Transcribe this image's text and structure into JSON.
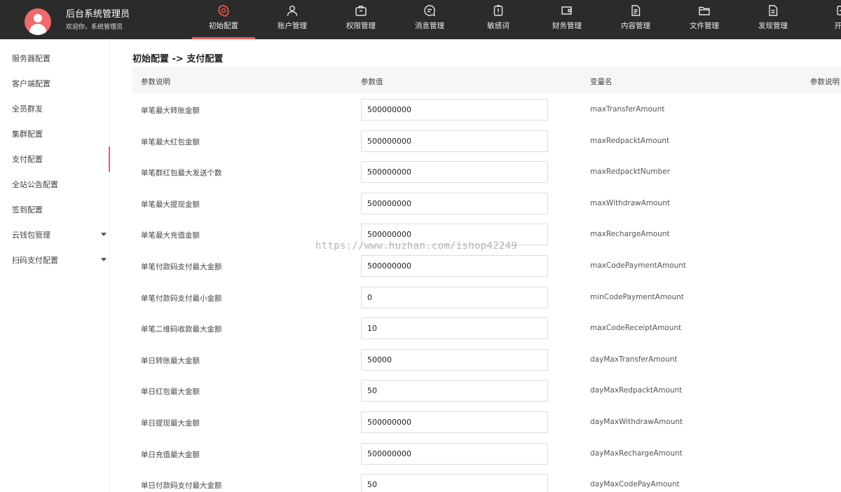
{
  "header": {
    "title": "后台系统管理员",
    "welcome": "欢迎你，系统管理员",
    "nav": [
      {
        "label": "初始配置",
        "icon": "gear-icon",
        "active": true
      },
      {
        "label": "账户管理",
        "icon": "user-icon",
        "active": false
      },
      {
        "label": "权限管理",
        "icon": "briefcase-icon",
        "active": false
      },
      {
        "label": "消息管理",
        "icon": "message-icon",
        "active": false
      },
      {
        "label": "敏感词",
        "icon": "alert-icon",
        "active": false
      },
      {
        "label": "财务管理",
        "icon": "wallet-icon",
        "active": false
      },
      {
        "label": "内容管理",
        "icon": "document-icon",
        "active": false
      },
      {
        "label": "文件管理",
        "icon": "folder-icon",
        "active": false
      },
      {
        "label": "发现管理",
        "icon": "file-icon",
        "active": false
      },
      {
        "label": "开放",
        "icon": "open-icon",
        "active": false
      }
    ]
  },
  "sidebar": {
    "items": [
      {
        "label": "服务器配置",
        "active": false,
        "has_submenu": false
      },
      {
        "label": "客户端配置",
        "active": false,
        "has_submenu": false
      },
      {
        "label": "全员群发",
        "active": false,
        "has_submenu": false
      },
      {
        "label": "集群配置",
        "active": false,
        "has_submenu": false
      },
      {
        "label": "支付配置",
        "active": true,
        "has_submenu": false
      },
      {
        "label": "全站公告配置",
        "active": false,
        "has_submenu": false
      },
      {
        "label": "签到配置",
        "active": false,
        "has_submenu": false
      },
      {
        "label": "云钱包管理",
        "active": false,
        "has_submenu": true
      },
      {
        "label": "扫码支付配置",
        "active": false,
        "has_submenu": true
      }
    ]
  },
  "main": {
    "breadcrumb": "初始配置 -> 支付配置",
    "columns": [
      "参数说明",
      "参数值",
      "变量名",
      "参数说明"
    ],
    "rows": [
      {
        "desc": "单笔最大转账金额",
        "value": "500000000",
        "var": "maxTransferAmount"
      },
      {
        "desc": "单笔最大红包金额",
        "value": "500000000",
        "var": "maxRedpacktAmount"
      },
      {
        "desc": "单笔群红包最大发送个数",
        "value": "500000000",
        "var": "maxRedpacktNumber"
      },
      {
        "desc": "单笔最大提现金额",
        "value": "500000000",
        "var": "maxWithdrawAmount"
      },
      {
        "desc": "单笔最大充值金额",
        "value": "500000000",
        "var": "maxRechargeAmount"
      },
      {
        "desc": "单笔付款码支付最大金额",
        "value": "500000000",
        "var": "maxCodePaymentAmount"
      },
      {
        "desc": "单笔付款码支付最小金额",
        "value": "0",
        "var": "minCodePaymentAmount"
      },
      {
        "desc": "单笔二维码收款最大金额",
        "value": "10",
        "var": "maxCodeReceiptAmount"
      },
      {
        "desc": "单日转账最大金额",
        "value": "50000",
        "var": "dayMaxTransferAmount"
      },
      {
        "desc": "单日红包最大金额",
        "value": "50",
        "var": "dayMaxRedpacktAmount"
      },
      {
        "desc": "单日提现最大金额",
        "value": "500000000",
        "var": "dayMaxWithdrawAmount"
      },
      {
        "desc": "单日充值最大金额",
        "value": "500000000",
        "var": "dayMaxRechargeAmount"
      },
      {
        "desc": "单日付款码支付最大金额",
        "value": "50",
        "var": "dayMaxCodePayAmount"
      }
    ]
  },
  "watermark": "https://www.huzhan.com/ishop42249",
  "colors": {
    "accent": "#f15a5a",
    "header_bg": "#2b2b2b",
    "avatar": "#ef6a6a"
  }
}
